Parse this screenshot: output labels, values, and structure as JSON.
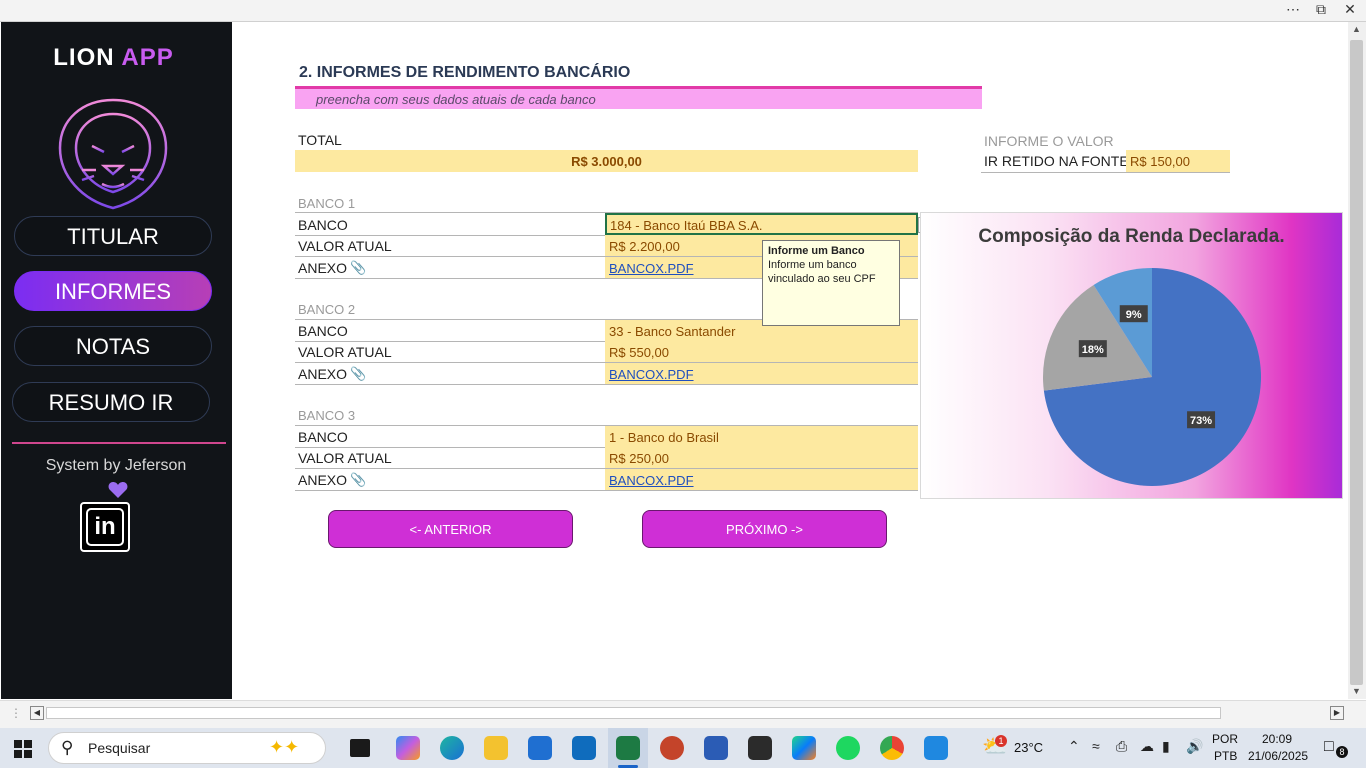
{
  "window": {
    "more_icon": "⋯",
    "restore_icon": "⧉",
    "close_icon": "✕"
  },
  "sidebar": {
    "logo_white": "LION ",
    "logo_pink": "APP",
    "nav": [
      {
        "label": "TITULAR",
        "active": false
      },
      {
        "label": "INFORMES",
        "active": true
      },
      {
        "label": "NOTAS",
        "active": false
      },
      {
        "label": "RESUMO IR",
        "active": false
      }
    ],
    "system_by": "System by   Jeferson",
    "heart_icon": "heart-icon",
    "linkedin_text": "in"
  },
  "main": {
    "title": "2. INFORMES DE RENDIMENTO BANCÁRIO",
    "subtitle": "preencha com seus dados atuais de cada banco",
    "total_label": "TOTAL",
    "total_value": "R$ 3.000,00",
    "informe_label": "INFORME O VALOR",
    "ir_label": "IR RETIDO NA FONTE",
    "ir_value": "R$ 150,00",
    "banks": [
      {
        "header": "BANCO 1",
        "banco_label": "BANCO",
        "banco_value": "184 - Banco Itaú BBA S.A.",
        "valor_label": "VALOR ATUAL",
        "valor_value": "R$ 2.200,00",
        "anexo_label": "ANEXO",
        "anexo_value": "BANCOX.PDF"
      },
      {
        "header": "BANCO 2",
        "banco_label": "BANCO",
        "banco_value": "33 - Banco Santander",
        "valor_label": "VALOR ATUAL",
        "valor_value": "R$ 550,00",
        "anexo_label": "ANEXO",
        "anexo_value": "BANCOX.PDF"
      },
      {
        "header": "BANCO 3",
        "banco_label": "BANCO",
        "banco_value": "1 - Banco do Brasil",
        "valor_label": "VALOR ATUAL",
        "valor_value": "R$ 250,00",
        "anexo_label": "ANEXO",
        "anexo_value": "BANCOX.PDF"
      }
    ],
    "tooltip": {
      "title": "Informe um Banco",
      "body": "Informe um banco vinculado ao seu CPF"
    },
    "btn_prev": "<- ANTERIOR",
    "btn_next": "PRÓXIMO ->"
  },
  "chart_data": {
    "type": "pie",
    "title": "Composição da Renda Declarada.",
    "values": [
      73,
      18,
      9
    ],
    "labels": [
      "73%",
      "18%",
      "9%"
    ],
    "colors": [
      "#4472c4",
      "#a5a5a5",
      "#5b9bd5"
    ]
  },
  "taskbar": {
    "search_placeholder": "Pesquisar",
    "weather": "23°C",
    "lang1": "POR",
    "lang2": "PTB",
    "time": "20:09",
    "date": "21/06/2025",
    "notif_count": "8",
    "weather_badge": "1"
  }
}
